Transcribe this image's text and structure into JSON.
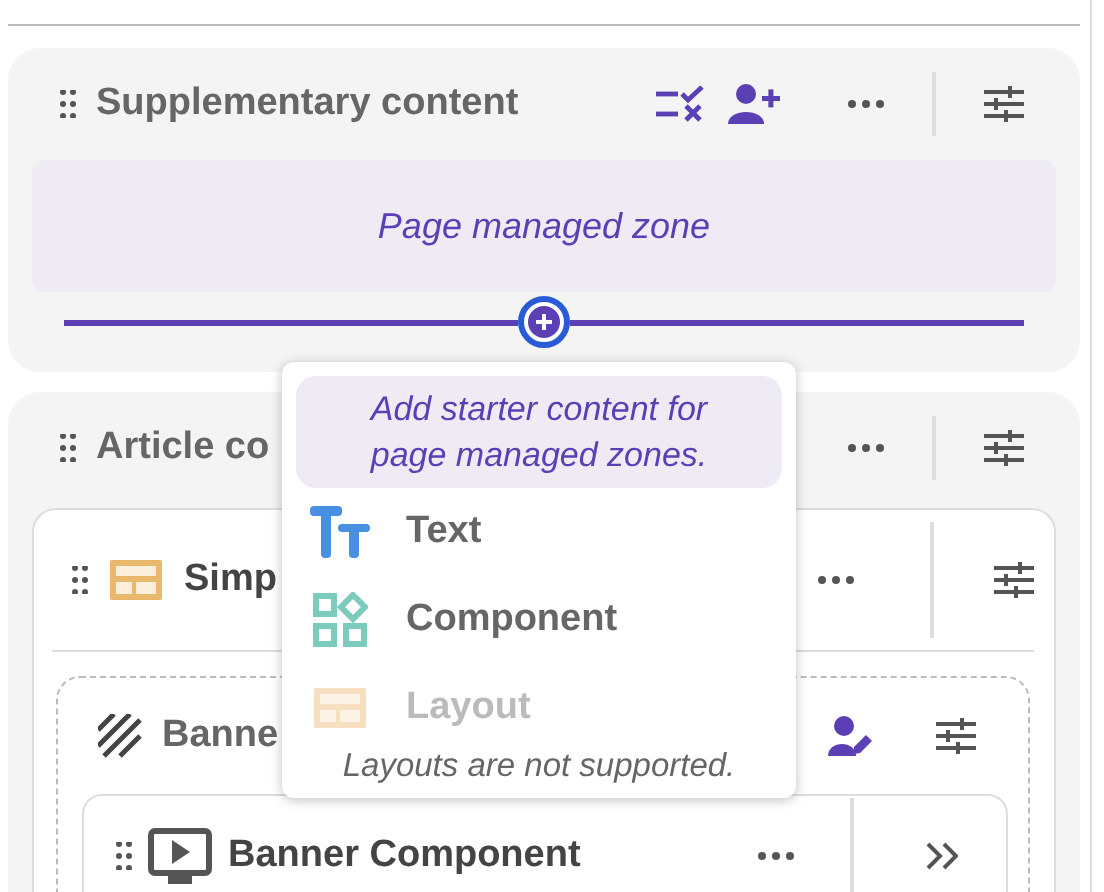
{
  "supplementary": {
    "title": "Supplementary content",
    "zone": "Page managed zone"
  },
  "article": {
    "title": "Article co",
    "layout": {
      "title": "Simp",
      "banner_zone": {
        "title": "Banne",
        "component": {
          "title": "Banner Component"
        }
      }
    }
  },
  "add_menu": {
    "hint": "Add starter content for page managed zones.",
    "items": [
      {
        "kind": "text",
        "label": "Text",
        "disabled": false
      },
      {
        "kind": "component",
        "label": "Component",
        "disabled": false
      },
      {
        "kind": "layout",
        "label": "Layout",
        "disabled": true
      }
    ],
    "note": "Layouts are not supported."
  }
}
